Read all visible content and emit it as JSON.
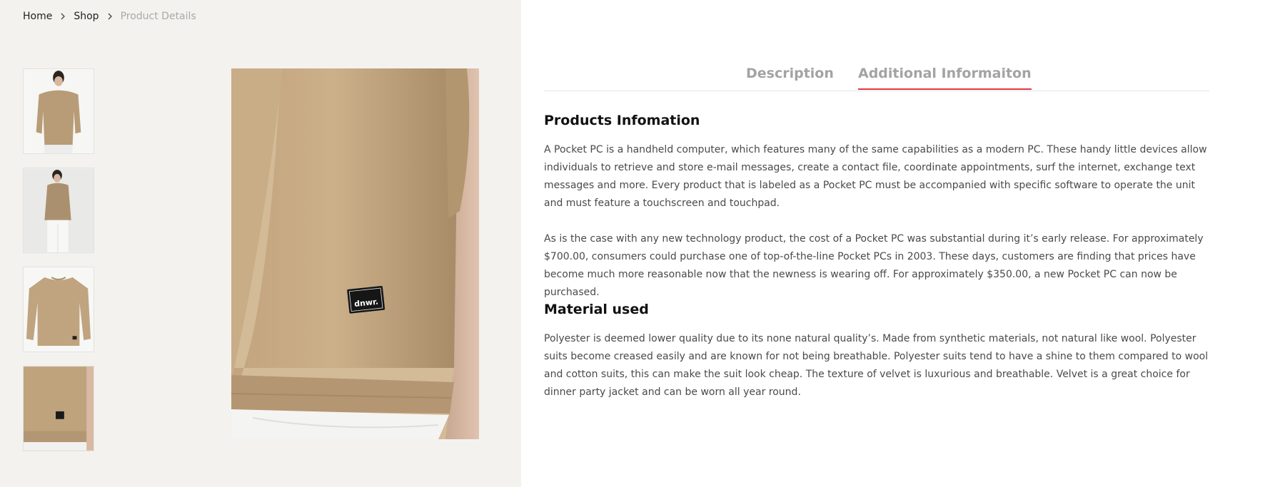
{
  "breadcrumb": {
    "items": [
      "Home",
      "Shop"
    ],
    "current": "Product Details"
  },
  "gallery": {
    "thumbnails": [
      "thumbnail-front-model",
      "thumbnail-side-model",
      "thumbnail-flat-sweater",
      "thumbnail-detail-hem"
    ],
    "main_image": "sweater-hem-detail-image",
    "label_text": "dnwr."
  },
  "tabs": [
    {
      "label": "Description",
      "active": false
    },
    {
      "label": "Additional Informaiton",
      "active": true
    }
  ],
  "content": {
    "section1_title": "Products Infomation",
    "section1_para1": "A Pocket PC is a handheld computer, which features many of the same capabilities as a modern PC. These handy little devices allow individuals to retrieve and store e-mail messages, create a contact file, coordinate appointments, surf the internet, exchange text messages and more. Every product that is labeled as a Pocket PC must be accompanied with specific software to operate the unit and must feature a touchscreen and touchpad.",
    "section1_para2": "As is the case with any new technology product, the cost of a Pocket PC was substantial during it’s early release. For approximately $700.00, consumers could purchase one of top-of-the-line Pocket PCs in 2003. These days, customers are finding that prices have become much more reasonable now that the newness is wearing off. For approximately $350.00, a new Pocket PC can now be purchased.",
    "section2_title": "Material used",
    "section2_para1": "Polyester is deemed lower quality due to its none natural quality’s. Made from synthetic materials, not natural like wool. Polyester suits become creased easily and are known for not being breathable. Polyester suits tend to have a shine to them compared to wool and cotton suits, this can make the suit look cheap. The texture of velvet is luxurious and breathable. Velvet is a great choice for dinner party jacket and can be worn all year round."
  },
  "colors": {
    "gallery_bg": "#f3f2ef",
    "accent": "#e2363e",
    "sweater": "#c4a883"
  }
}
